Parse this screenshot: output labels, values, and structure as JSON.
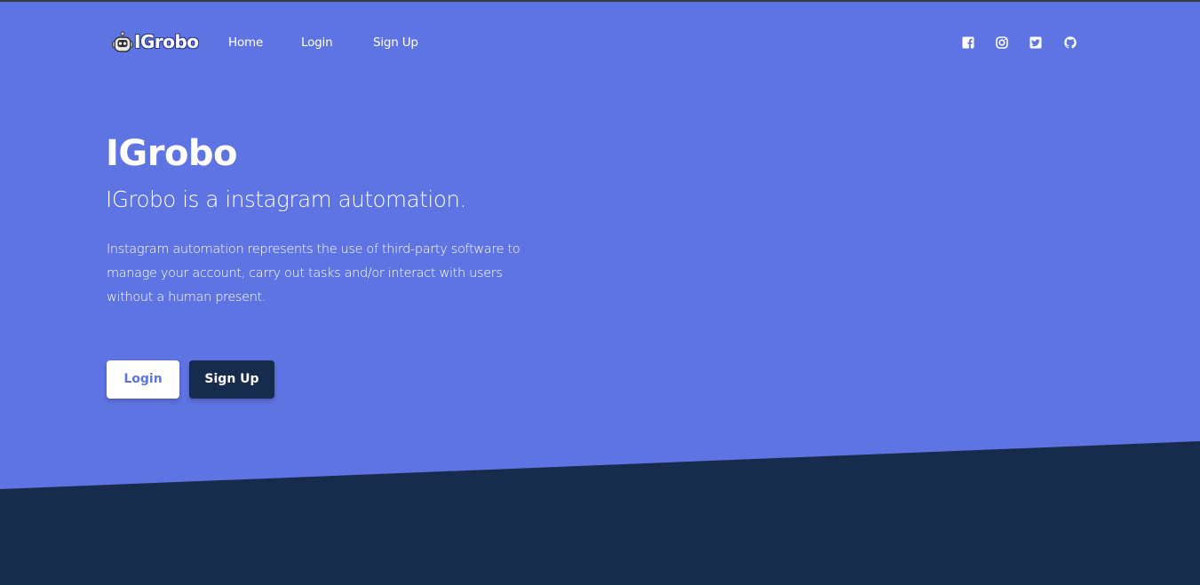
{
  "navbar": {
    "brand": "IGrobo",
    "links": [
      {
        "label": "Home"
      },
      {
        "label": "Login"
      },
      {
        "label": "Sign Up"
      }
    ],
    "social_icons": [
      "facebook-square-icon",
      "instagram-icon",
      "twitter-square-icon",
      "github-icon"
    ]
  },
  "hero": {
    "title": "IGrobo",
    "subtitle": "IGrobo is a instagram automation.",
    "description": "Instagram automation represents the use of third-party software to manage your account, carry out tasks and/or interact with users without a human present.",
    "buttons": {
      "login_label": "Login",
      "signup_label": "Sign Up"
    }
  },
  "colors": {
    "primary": "#5f74e3",
    "dark": "#172b4d",
    "white": "#ffffff"
  }
}
